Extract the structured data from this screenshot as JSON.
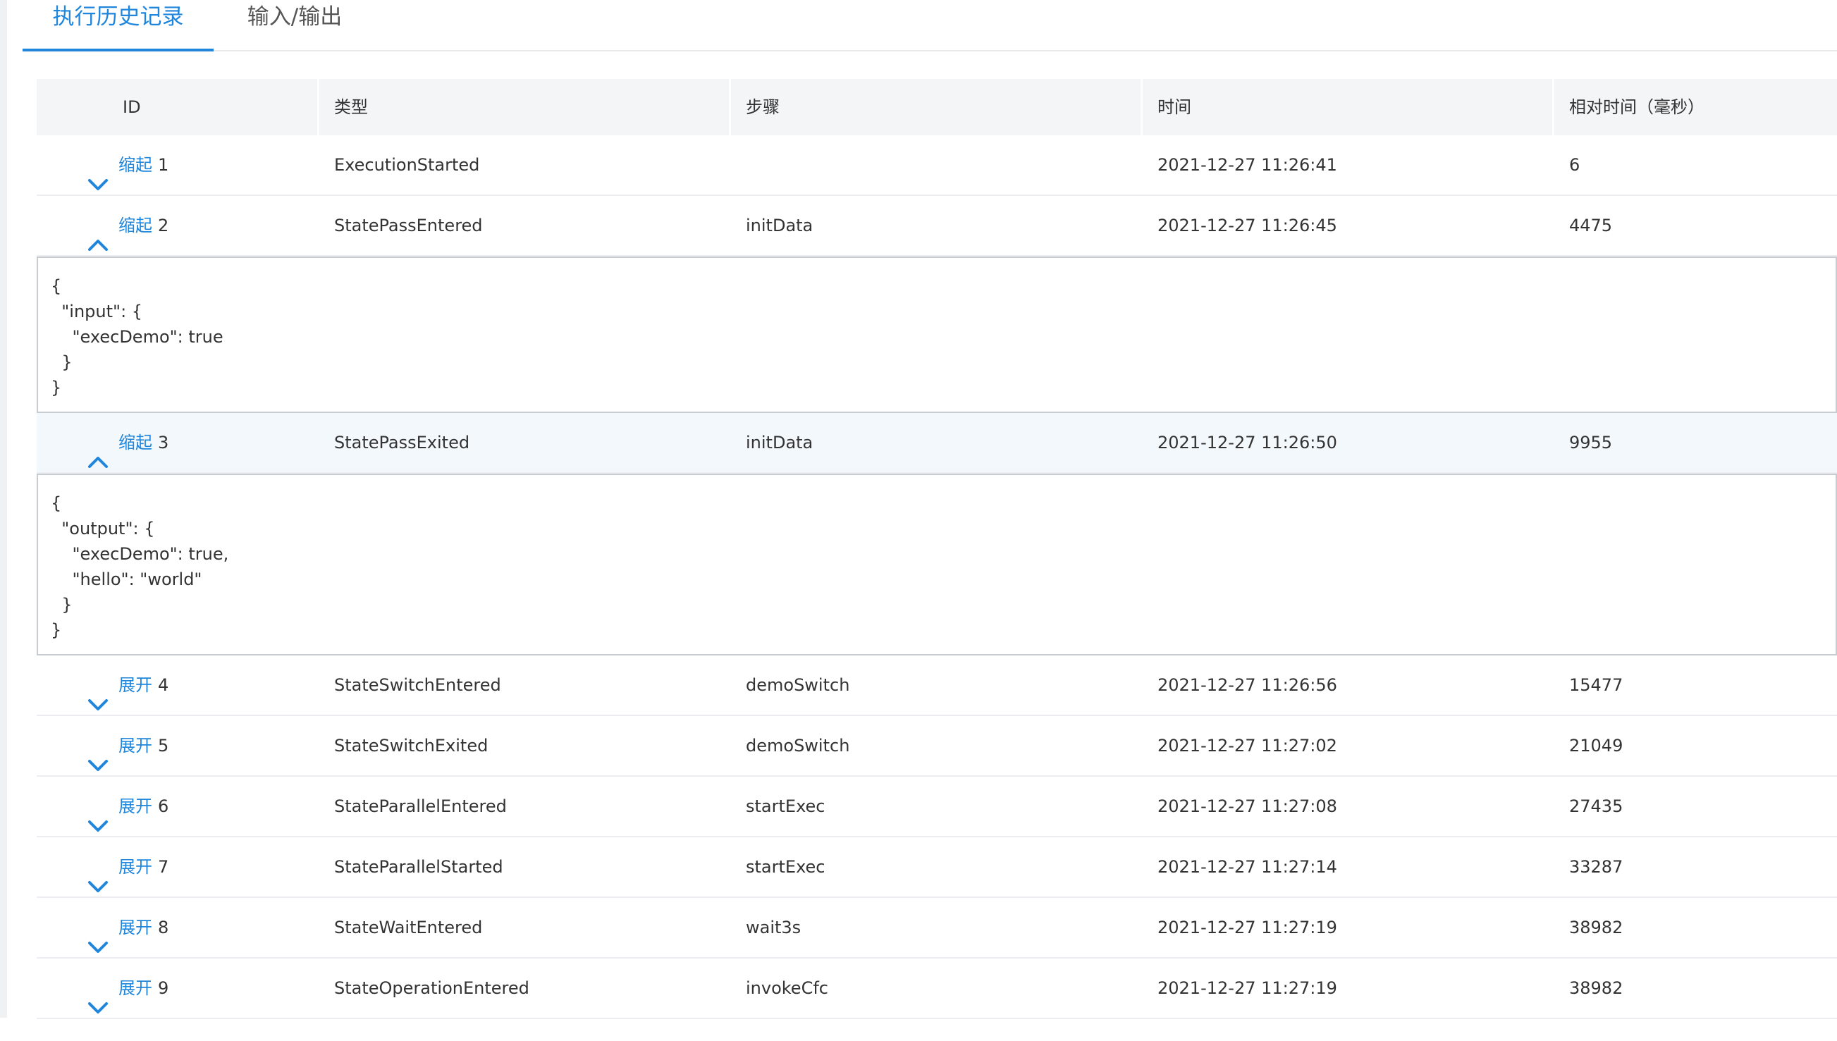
{
  "tabs": [
    {
      "label": "执行历史记录",
      "active": true
    },
    {
      "label": "输入/输出",
      "active": false
    }
  ],
  "columns": [
    "ID",
    "类型",
    "步骤",
    "时间",
    "相对时间（毫秒）"
  ],
  "rows": [
    {
      "toggle": "缩起",
      "expanded": false,
      "id": "1",
      "type": "ExecutionStarted",
      "step": "",
      "time": "2021-12-27 11:26:41",
      "relative": "6"
    },
    {
      "toggle": "缩起",
      "expanded": true,
      "id": "2",
      "type": "StatePassEntered",
      "step": "initData",
      "time": "2021-12-27 11:26:45",
      "relative": "4475",
      "detail": [
        "{",
        "  \"input\": {",
        "    \"execDemo\": true",
        "  }",
        "}"
      ]
    },
    {
      "toggle": "缩起",
      "expanded": true,
      "id": "3",
      "type": "StatePassExited",
      "step": "initData",
      "time": "2021-12-27 11:26:50",
      "relative": "9955",
      "detail": [
        "{",
        "  \"output\": {",
        "    \"execDemo\": true,",
        "    \"hello\": \"world\"",
        "  }",
        "}"
      ]
    },
    {
      "toggle": "展开",
      "expanded": false,
      "id": "4",
      "type": "StateSwitchEntered",
      "step": "demoSwitch",
      "time": "2021-12-27 11:26:56",
      "relative": "15477"
    },
    {
      "toggle": "展开",
      "expanded": false,
      "id": "5",
      "type": "StateSwitchExited",
      "step": "demoSwitch",
      "time": "2021-12-27 11:27:02",
      "relative": "21049"
    },
    {
      "toggle": "展开",
      "expanded": false,
      "id": "6",
      "type": "StateParallelEntered",
      "step": "startExec",
      "time": "2021-12-27 11:27:08",
      "relative": "27435"
    },
    {
      "toggle": "展开",
      "expanded": false,
      "id": "7",
      "type": "StateParallelStarted",
      "step": "startExec",
      "time": "2021-12-27 11:27:14",
      "relative": "33287"
    },
    {
      "toggle": "展开",
      "expanded": false,
      "id": "8",
      "type": "StateWaitEntered",
      "step": "wait3s",
      "time": "2021-12-27 11:27:19",
      "relative": "38982"
    },
    {
      "toggle": "展开",
      "expanded": false,
      "id": "9",
      "type": "StateOperationEntered",
      "step": "invokeCfc",
      "time": "2021-12-27 11:27:19",
      "relative": "38982"
    }
  ],
  "colors": {
    "accent": "#1f86dc",
    "header_bg": "#f4f5f7",
    "highlight_row": "#f3f8fd"
  },
  "icons": {
    "expanded": "chevron-up-icon",
    "collapsed": "chevron-down-icon"
  }
}
